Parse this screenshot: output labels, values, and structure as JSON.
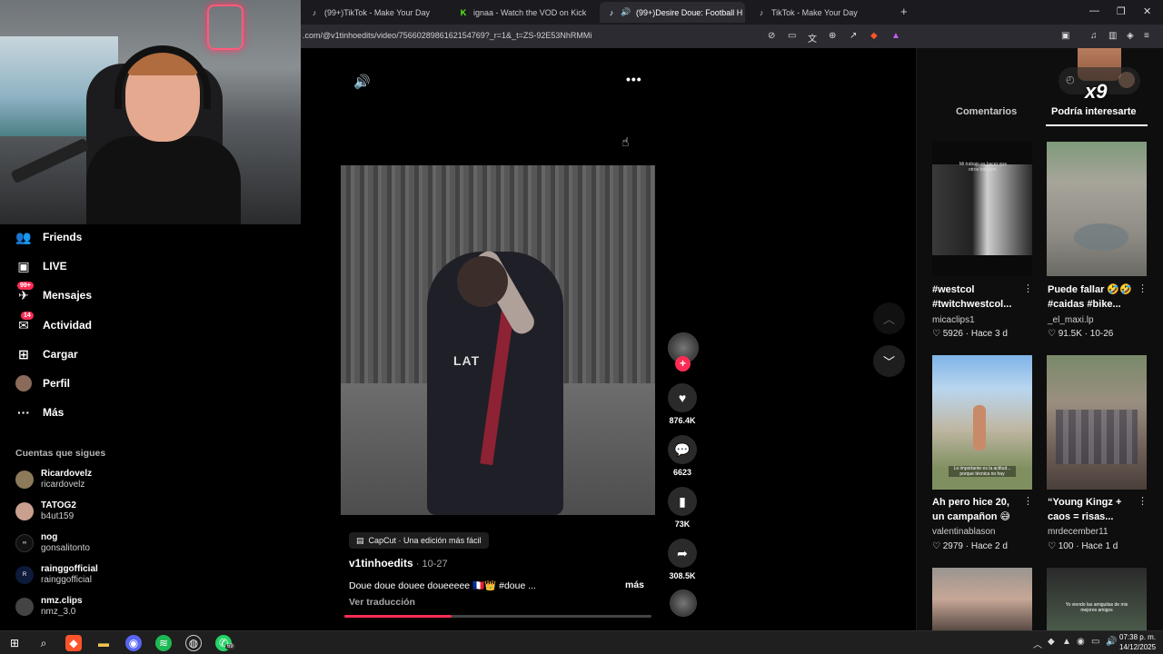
{
  "browser": {
    "tabs": [
      {
        "label": "(99+)TikTok - Make Your Day",
        "icon": "tiktok-icon",
        "active": false
      },
      {
        "label": "ignaa - Watch the VOD on Kick",
        "icon": "kick-icon",
        "active": false
      },
      {
        "label": "(99+)Desire Doue: Football H",
        "icon": "tiktok-icon",
        "active": true
      },
      {
        "label": "TikTok - Make Your Day",
        "icon": "tiktok-icon",
        "active": false
      }
    ],
    "new_tab": "+",
    "url": ".com/@v1tinhoedits/video/7566028986162154769?_r=1&_t=ZS-92E53NhRMMi",
    "window_controls": {
      "minimize": "—",
      "maximize": "❐",
      "close": "✕"
    }
  },
  "sidebar": {
    "nav": [
      {
        "label": "Friends",
        "icon": "friends-icon",
        "glyph": "👥",
        "badge": ""
      },
      {
        "label": "LIVE",
        "icon": "live-icon",
        "glyph": "▣",
        "badge": ""
      },
      {
        "label": "Mensajes",
        "icon": "messages-icon",
        "glyph": "✈",
        "badge": "99+"
      },
      {
        "label": "Actividad",
        "icon": "activity-icon",
        "glyph": "✉",
        "badge": "14"
      },
      {
        "label": "Cargar",
        "icon": "upload-icon",
        "glyph": "⊞",
        "badge": ""
      },
      {
        "label": "Perfil",
        "icon": "profile-icon",
        "glyph": "●",
        "badge": ""
      },
      {
        "label": "Más",
        "icon": "more-icon",
        "glyph": "···",
        "badge": ""
      }
    ],
    "following_title": "Cuentas que sigues",
    "following": [
      {
        "name": "Ricardovelz",
        "handle": "ricardovelz"
      },
      {
        "name": "TATOG2",
        "handle": "b4ut159"
      },
      {
        "name": "nog",
        "handle": "gonsalitonto"
      },
      {
        "name": "rainggofficial",
        "handle": "rainggofficial"
      },
      {
        "name": "nmz.clips",
        "handle": "nmz_3.0"
      }
    ]
  },
  "video": {
    "shirt_text": "LAT",
    "capcut_label": "CapCut · Una edición más fácil",
    "author": "v1tinhoedits",
    "date": " · 10-27",
    "caption": "Doue doue douee doueeeee 🇫🇷👑 #doue ...",
    "more": "más",
    "translate": "Ver traducción",
    "progress": 0.35
  },
  "actions": {
    "likes": "876.4K",
    "comments": "6623",
    "saves": "73K",
    "shares": "308.5K"
  },
  "right_panel": {
    "tabs": [
      "Comentarios",
      "Podría interesarte"
    ],
    "active_tab": 1,
    "overlay_text": "x9",
    "cards": [
      {
        "title1": "#westcol",
        "title2": "#twitchwestcol...",
        "user": "micaclips1",
        "likes": "5926",
        "when": "Hace 3 d",
        "thumb_text": "Mi trabajo es hacer que otros trabajen."
      },
      {
        "title1": "Puede fallar 🤣🤣",
        "title2": "#caidas #bike...",
        "user": "_el_maxi.lp",
        "likes": "91.5K",
        "when": "10-26",
        "thumb_text": ""
      },
      {
        "title1": "Ah pero hice 20,",
        "title2": "un campañon 😅",
        "user": "valentinablason",
        "likes": "2979",
        "when": "Hace 2 d",
        "thumb_text": "Lo importante es la actitud... porque técnica no hay"
      },
      {
        "title1": "“Young Kingz +",
        "title2": "caos = risas...",
        "user": "mrdecember11",
        "likes": "100",
        "when": "Hace 1 d",
        "thumb_text": ""
      },
      {
        "title1": "",
        "title2": "",
        "user": "",
        "likes": "",
        "when": "",
        "thumb_text": ""
      },
      {
        "title1": "",
        "title2": "",
        "user": "",
        "likes": "",
        "when": "",
        "thumb_text": "Yo viendo las amiguitas de mis mejores amigos"
      }
    ]
  },
  "taskbar": {
    "time": "07:38 p. m.",
    "date": "14/12/2025",
    "whatsapp_badge": "69"
  },
  "colors": {
    "accent": "#fe2c55",
    "background": "#000000",
    "panel": "#0e0e0e"
  }
}
